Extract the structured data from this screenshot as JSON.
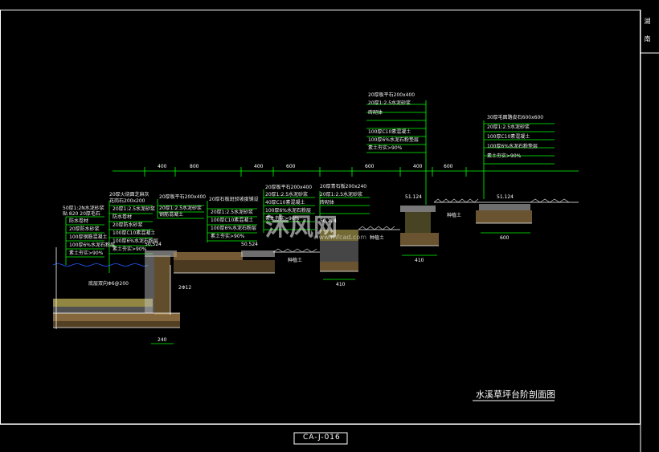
{
  "drawing": {
    "title": "水溪草坪台阶剖面图",
    "number": "CA-J-016",
    "side_label_1": "湖",
    "side_label_2": "南"
  },
  "dimensions": [
    "400",
    "800",
    "400",
    "600",
    "600",
    "400",
    "600"
  ],
  "lower_dims": {
    "d240": "240",
    "d410": "410",
    "d410b": "410",
    "d600": "600"
  },
  "elevations": {
    "e1": "50.524",
    "e2": "50.524",
    "e3": "50.224",
    "e4": "51.124",
    "e5": "51.124"
  },
  "notes": {
    "group_a": [
      "50厚1:2N水泥砂浆",
      "贴 820 20厚毛石",
      "防水卷材",
      "20厚防水砂浆",
      "100厚钢筋混凝土",
      "100厚6%水泥石粉层",
      "素土夯实>90%"
    ],
    "group_b": [
      "20厚火烧面芝麻灰",
      "花岗石200x200",
      "20厚1:2.5水泥砂浆",
      "防水卷材",
      "20厚防水砂浆",
      "100厚C10素混凝土",
      "100厚6%水泥石粉层",
      "素土夯实>90%"
    ],
    "group_c": [
      "20厚板平石200x400",
      "20厚1:2.5水泥砂浆",
      "钢筋混凝土"
    ],
    "group_d": [
      "20厚石板斑驳坡度铺设",
      "20厚1:2.5水泥砂浆",
      "100厚C10素混凝土",
      "100厚6%水泥石粉层",
      "素土夯实>90%"
    ],
    "group_e": [
      "20厚板平石200x400",
      "20厚1:2.5水泥砂浆",
      "40厚C10素混凝土",
      "100厚6%水泥石粉层",
      "素土夯实>90%"
    ],
    "group_f": [
      "20厚青石板200x240",
      "20厚1:2.5水泥砂浆",
      "砖砌体"
    ],
    "group_g": [
      "20厚板平石200x400",
      "20厚1:2.5水泥砂浆",
      "砖砌体",
      "100厚C10素混凝土",
      "100厚6%水泥石粉垫层",
      "素土夯实>90%"
    ],
    "group_h": [
      "30厚毛面路皮石600x600",
      "20厚1:2.5水泥砂浆",
      "100厚C10素混凝土",
      "100厚6%水泥石粉垫层",
      "素土夯实>90%"
    ],
    "rebar": "底层双向Φ6@200",
    "rebar2": "2Φ12",
    "soil1": "种植土",
    "soil2": "种植土",
    "soil3": "种植土"
  },
  "watermark": {
    "text": "沐风网",
    "url": "www.mfcad.com"
  },
  "colors": {
    "line": "#ffffff",
    "leader": "#00ff00",
    "water": "#1e5cff",
    "fill_earth": "#b08a50",
    "fill_gravel": "#c8c8c8",
    "fill_grass": "#cfc060"
  }
}
